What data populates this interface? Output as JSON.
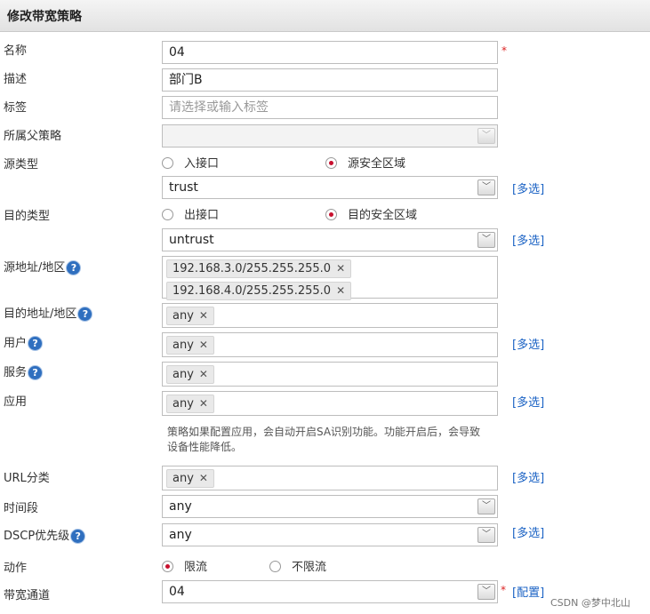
{
  "title": "修改带宽策略",
  "fields": {
    "name": {
      "label": "名称",
      "value": "04"
    },
    "desc": {
      "label": "描述",
      "value": "部门B"
    },
    "tag": {
      "label": "标签",
      "placeholder": "请选择或输入标签"
    },
    "parent": {
      "label": "所属父策略",
      "value": ""
    },
    "src_type": {
      "label": "源类型",
      "options": [
        "入接口",
        "源安全区域"
      ],
      "selected": "源安全区域",
      "zone_value": "trust"
    },
    "dst_type": {
      "label": "目的类型",
      "options": [
        "出接口",
        "目的安全区域"
      ],
      "selected": "目的安全区域",
      "zone_value": "untrust"
    },
    "src_addr": {
      "label": "源地址/地区",
      "tags": [
        "192.168.3.0/255.255.255.0",
        "192.168.4.0/255.255.255.0"
      ]
    },
    "dst_addr": {
      "label": "目的地址/地区",
      "tags": [
        "any"
      ]
    },
    "user": {
      "label": "用户",
      "tags": [
        "any"
      ]
    },
    "service": {
      "label": "服务",
      "tags": [
        "any"
      ]
    },
    "app": {
      "label": "应用",
      "tags": [
        "any"
      ],
      "note": "策略如果配置应用，会自动开启SA识别功能。功能开启后，会导致设备性能降低。"
    },
    "url": {
      "label": "URL分类",
      "tags": [
        "any"
      ]
    },
    "time": {
      "label": "时间段",
      "value": "any"
    },
    "dscp": {
      "label": "DSCP优先级",
      "value": "any"
    },
    "action": {
      "label": "动作",
      "options": [
        "限流",
        "不限流"
      ],
      "selected": "限流"
    },
    "channel": {
      "label": "带宽通道",
      "value": "04"
    }
  },
  "links": {
    "multi": "[多选]",
    "config": "[配置]"
  },
  "required_mark": "*",
  "help_glyph": "?",
  "remove_glyph": "✕",
  "dropdown_glyph": "﹀",
  "watermark": "CSDN @梦中北山",
  "colors": {
    "link": "#1a62c4",
    "required": "#d22222",
    "radio_selected": "#c8102e",
    "help": "#2f6fbf"
  }
}
